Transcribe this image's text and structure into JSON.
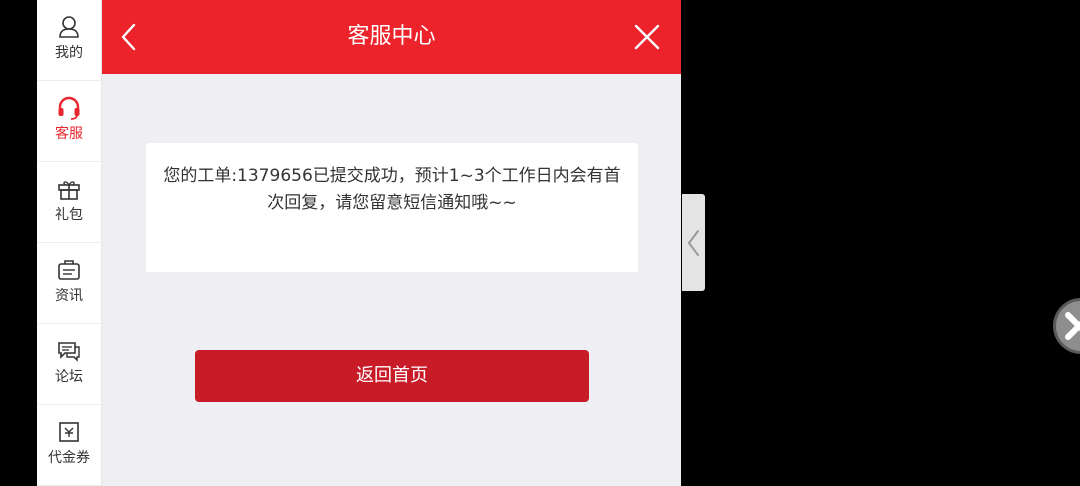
{
  "sidebar": {
    "items": [
      {
        "label": "我的",
        "icon": "user-icon"
      },
      {
        "label": "客服",
        "icon": "headset-icon",
        "active": true
      },
      {
        "label": "礼包",
        "icon": "gift-icon"
      },
      {
        "label": "资讯",
        "icon": "news-icon"
      },
      {
        "label": "论坛",
        "icon": "forum-icon"
      },
      {
        "label": "代金券",
        "icon": "voucher-icon"
      }
    ]
  },
  "header": {
    "title": "客服中心",
    "back_icon": "chevron-left-icon",
    "close_icon": "close-icon"
  },
  "message": {
    "text": "您的工单:1379656已提交成功，预计1~3个工作日内会有首次回复，请您留意短信通知哦~~"
  },
  "actions": {
    "home_label": "返回首页"
  },
  "colors": {
    "brand_red": "#ec232b",
    "button_red": "#c81b28",
    "panel_bg": "#efeef3",
    "active_label": "#e8262e"
  }
}
